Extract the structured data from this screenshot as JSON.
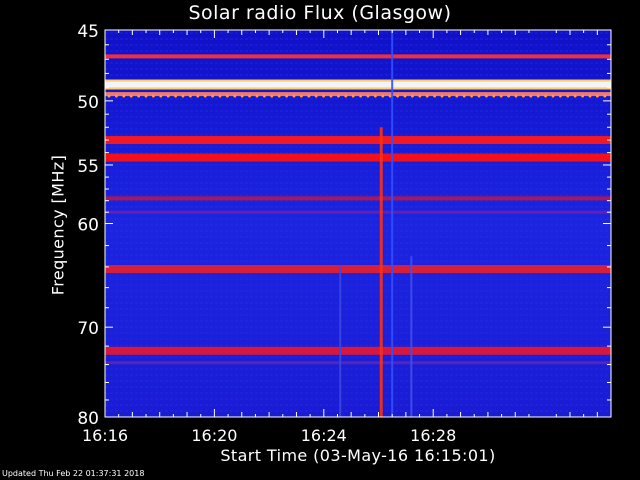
{
  "chart_data": {
    "type": "heatmap",
    "title": "Solar radio Flux (Glasgow)",
    "xlabel": "Start Time (03-May-16 16:15:01)",
    "ylabel": "Frequency [MHz]",
    "x_range_minutes": [
      16.0,
      34.5
    ],
    "x_ticks": [
      {
        "label": "16:16",
        "value": 16
      },
      {
        "label": "16:20",
        "value": 20
      },
      {
        "label": "16:24",
        "value": 24
      },
      {
        "label": "16:28",
        "value": 28
      }
    ],
    "y_scale": "log",
    "ylim": [
      45,
      80
    ],
    "y_ticks": [
      45,
      50,
      55,
      60,
      70,
      80
    ],
    "background_color": "#1818d8",
    "bands": [
      {
        "freq": 46.8,
        "intensity": "medium",
        "color": "#ff3030"
      },
      {
        "freq": 48.8,
        "intensity": "saturated",
        "color": "#ffffff"
      },
      {
        "freq": 49.5,
        "intensity": "medium",
        "color": "#ff8060"
      },
      {
        "freq": 53.0,
        "intensity": "high",
        "color": "#ff1818"
      },
      {
        "freq": 54.4,
        "intensity": "high",
        "color": "#ff1010"
      },
      {
        "freq": 57.8,
        "intensity": "medium",
        "color": "#b01850"
      },
      {
        "freq": 59.0,
        "intensity": "low",
        "color": "#8020a0"
      },
      {
        "freq": 64.2,
        "intensity": "high",
        "color": "#e02030"
      },
      {
        "freq": 72.5,
        "intensity": "high",
        "color": "#e01838"
      },
      {
        "freq": 73.8,
        "intensity": "low",
        "color": "#7028a8"
      }
    ],
    "bursts": [
      {
        "time": 26.1,
        "freq_range": [
          52,
          80
        ],
        "color": "#ff3010"
      },
      {
        "time": 26.5,
        "freq_range": [
          45,
          80
        ],
        "color": "#3050ff"
      },
      {
        "time": 27.2,
        "freq_range": [
          63,
          80
        ],
        "color": "#4050e8"
      },
      {
        "time": 24.6,
        "freq_range": [
          64,
          80
        ],
        "color": "#3848e0"
      }
    ]
  },
  "footer": "Updated Thu Feb 22 01:37:31 2018"
}
